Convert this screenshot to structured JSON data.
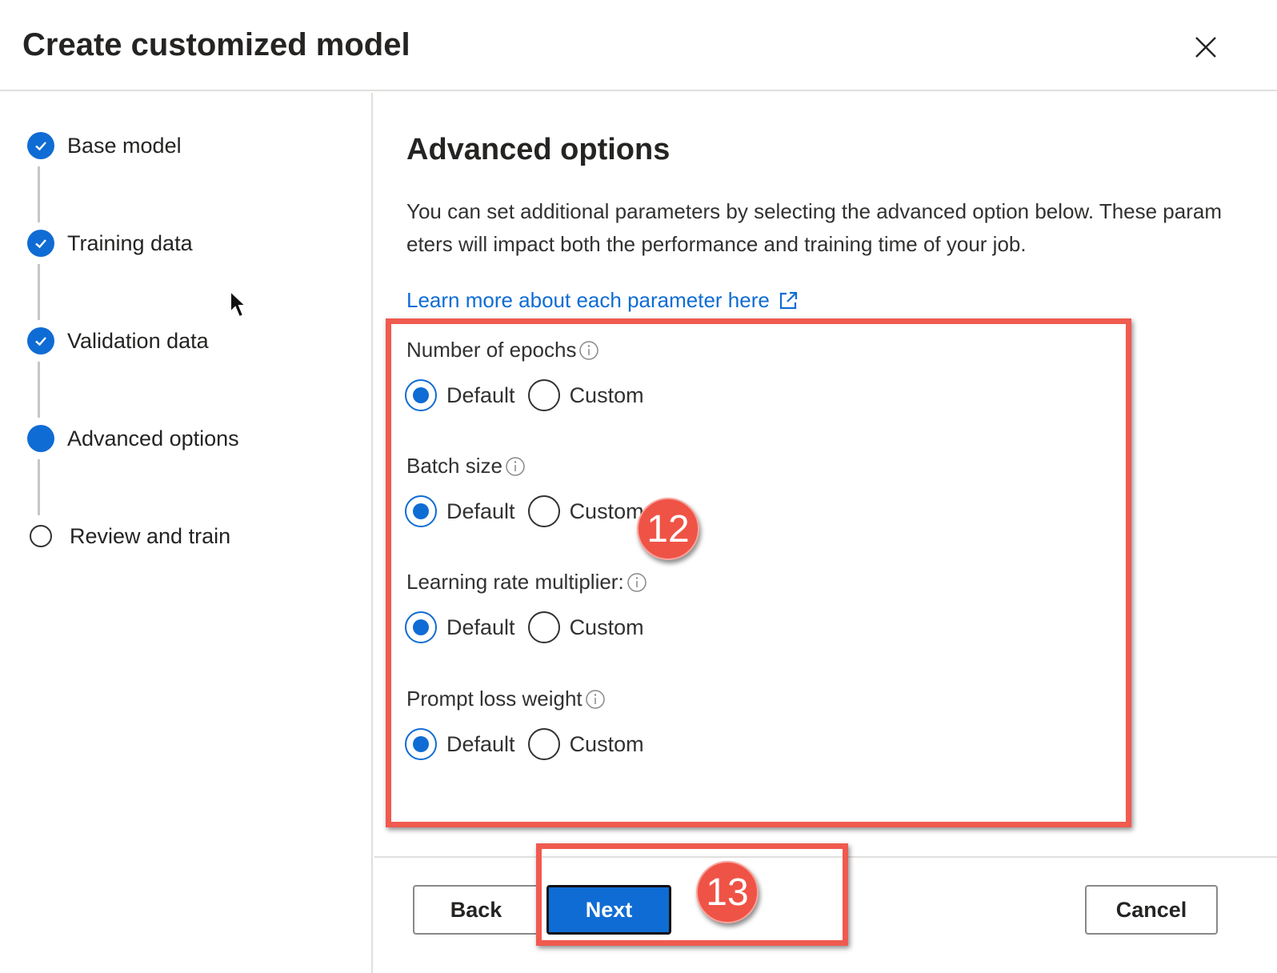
{
  "dialog": {
    "title": "Create customized model",
    "close_icon": "close-icon"
  },
  "steps": [
    {
      "label": "Base model",
      "state": "done"
    },
    {
      "label": "Training data",
      "state": "done"
    },
    {
      "label": "Validation data",
      "state": "done"
    },
    {
      "label": "Advanced options",
      "state": "current"
    },
    {
      "label": "Review and train",
      "state": "todo"
    }
  ],
  "main": {
    "title": "Advanced options",
    "description": "You can set additional parameters by selecting the advanced option below. These parameters will impact both the performance and training time of your job.",
    "learn_more_link": "Learn more about each parameter here",
    "link_icon": "external-link-icon"
  },
  "options": [
    {
      "label": "Number of epochs",
      "default_label": "Default",
      "custom_label": "Custom",
      "selected": "Default"
    },
    {
      "label": "Batch size",
      "default_label": "Default",
      "custom_label": "Custom",
      "selected": "Default"
    },
    {
      "label": "Learning rate multiplier:",
      "default_label": "Default",
      "custom_label": "Custom",
      "selected": "Default"
    },
    {
      "label": "Prompt loss weight",
      "default_label": "Default",
      "custom_label": "Custom",
      "selected": "Default"
    }
  ],
  "annotations": {
    "badge_options": "12",
    "badge_next": "13"
  },
  "footer": {
    "back_label": "Back",
    "next_label": "Next",
    "cancel_label": "Cancel"
  },
  "colors": {
    "accent": "#0f6cd4",
    "annotation": "#f05a4f"
  }
}
